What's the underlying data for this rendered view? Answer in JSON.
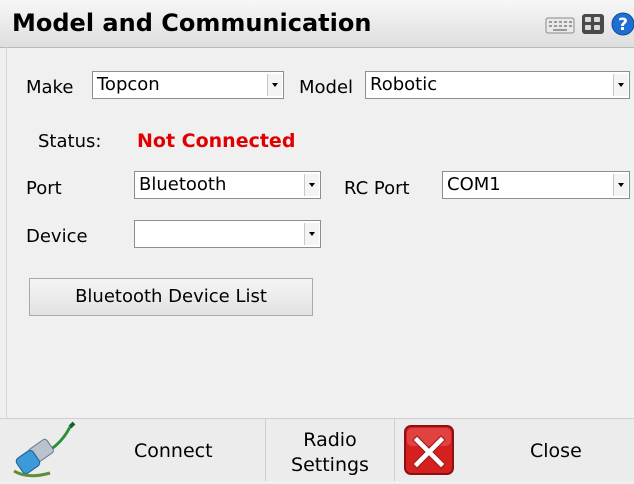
{
  "header": {
    "title": "Model and Communication",
    "icons": [
      "keyboard-icon",
      "calculator-icon",
      "help-icon"
    ]
  },
  "form": {
    "make_label": "Make",
    "make_value": "Topcon",
    "model_label": "Model",
    "model_value": "Robotic",
    "status_label": "Status:",
    "status_value": "Not Connected",
    "port_label": "Port",
    "port_value": "Bluetooth",
    "rcport_label": "RC Port",
    "rcport_value": "COM1",
    "device_label": "Device",
    "device_value": "",
    "bt_list_button": "Bluetooth Device List"
  },
  "bottom": {
    "connect_label": "Connect",
    "radio_label_line1": "Radio",
    "radio_label_line2": "Settings",
    "close_label": "Close"
  },
  "colors": {
    "status": "#e00000",
    "close_icon": "#d62020",
    "help_icon": "#1f6fd1",
    "connector_icon": "#2f8f3a"
  }
}
